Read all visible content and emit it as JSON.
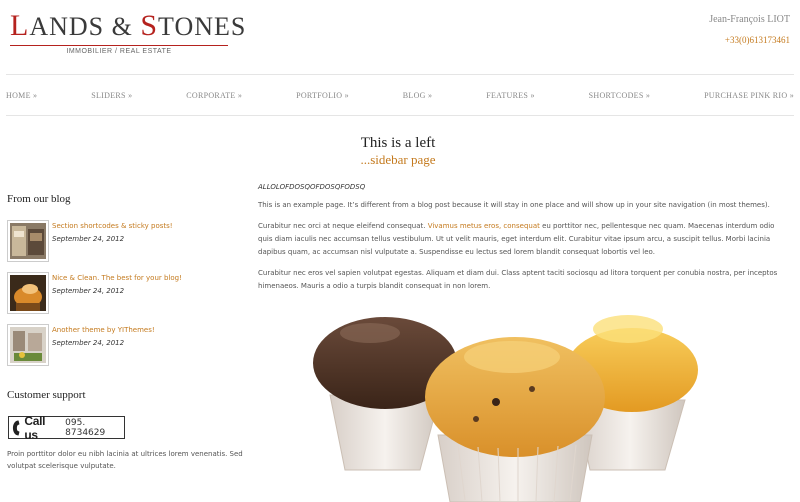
{
  "header": {
    "logo_first": "L",
    "logo_mid": "ANDS & ",
    "logo_s": "S",
    "logo_end": "TONES",
    "logo_sub": "IMMOBILIER / REAL ESTATE",
    "contact_name": "Jean-François LIOT",
    "contact_phone": "+33(0)613173461"
  },
  "nav": {
    "items": [
      {
        "label": "HOME »"
      },
      {
        "label": "SLIDERS »"
      },
      {
        "label": "CORPORATE »"
      },
      {
        "label": "PORTFOLIO »"
      },
      {
        "label": "BLOG »"
      },
      {
        "label": "FEATURES »"
      },
      {
        "label": "SHORTCODES »"
      },
      {
        "label": "PURCHASE PINK RIO »"
      }
    ]
  },
  "page": {
    "title_1": "This is a left",
    "title_2": "...sidebar page"
  },
  "sidebar": {
    "blog_heading": "From our blog",
    "posts": [
      {
        "title": "Section shortcodes & sticky posts!",
        "date": "September 24, 2012"
      },
      {
        "title": "Nice & Clean. The best for your blog!",
        "date": "September 24, 2012"
      },
      {
        "title": "Another theme by YIThemes!",
        "date": "September 24, 2012"
      }
    ],
    "support_heading": "Customer support",
    "call_label": "Call us",
    "call_number": "095. 8734629",
    "support_text": "Proin porttitor dolor eu nibh lacinia at ultrices lorem venenatis. Sed volutpat scelerisque vulputate."
  },
  "content": {
    "code_line": "ALLOLOFDOSQOFDOSQFODSQ",
    "para1": "This is an example page. It’s different from a blog post because it will stay in one place and will show up in your site navigation (in most themes).",
    "para2_start": "Curabitur nec orci at neque eleifend consequat. ",
    "para2_link": "Vivamus metus eros, consequat",
    "para2_end": " eu porttitor nec, pellentesque nec quam. Maecenas interdum odio quis diam iaculis nec accumsan tellus vestibulum. Ut ut velit mauris, eget interdum elit. Curabitur vitae ipsum arcu, a suscipit tellus. Morbi lacinia dapibus quam, ac accumsan nisl vulputate a. Suspendisse eu lectus sed lorem blandit consequat lobortis vel leo.",
    "para3": "Curabitur nec eros vel sapien volutpat egestas. Aliquam et diam dui. Class aptent taciti sociosqu ad litora torquent per conubia nostra, per inceptos himenaeos. Mauris a odio a turpis blandit consequat in non lorem."
  },
  "colors": {
    "accent": "#c47a1e",
    "logo_red": "#b5221e"
  }
}
